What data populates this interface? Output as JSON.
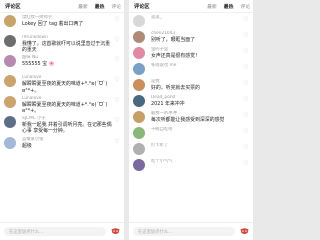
{
  "left": {
    "header": {
      "title": "评论区",
      "tabs": [
        {
          "label": "最新"
        },
        {
          "label": "最热"
        },
        {
          "label": "评论"
        }
      ]
    },
    "comments": [
      {
        "user": "漂红纹一师师学",
        "text": "Lokey 回了 tag 着出口两了",
        "likes": "",
        "color": "#c9a46a"
      },
      {
        "user": "r9runkdown",
        "text": "我懂了。这首歌就吓可以说里音过于沉重的重天",
        "likes": "",
        "color": "#6d6d6d"
      },
      {
        "user": "甜味 Nu",
        "text": "555555 宝 🌸",
        "likes": "",
        "color": "#b98ab0"
      },
      {
        "user": "Lunalove",
        "text": "解瞬瞬夏至夜的夏天的味道+*.°ʚ(ˊᗜˋ)ɞ°*+。",
        "likes": "",
        "color": "#caa36e"
      },
      {
        "user": "Lunalove",
        "text": "解瞬瞬夏至夜的夏天的味道+*.°ʚ(ˊᗜˋ)ɞ°*+。",
        "likes": "",
        "color": "#caa36e"
      },
      {
        "user": "SJCMC 小子",
        "text": "新我一起我 并着引调听月亮。在记那些偶心事 享受每一分钟。",
        "likes": "",
        "color": "#5f6e88"
      },
      {
        "user": "蓝莓某小兔",
        "text": "超级",
        "likes": "",
        "color": "#a3b8d6"
      }
    ],
    "input": {
      "placeholder": "在这里说点什么..."
    }
  },
  "right": {
    "header": {
      "title": "评论区",
      "tabs": [
        {
          "label": "最新"
        },
        {
          "label": "最热"
        },
        {
          "label": "评论"
        }
      ]
    },
    "comments": [
      {
        "user": "淡淡_",
        "text": "",
        "likes": "",
        "color": "#d8d8d8"
      },
      {
        "user": "chen21043",
        "text": "别听了，眼眶当面了",
        "likes": "",
        "color": "#b08a78"
      },
      {
        "user": "萤的子萤",
        "text": "女声还真是很有感觉！",
        "likes": "",
        "color": "#e08aa4"
      },
      {
        "user": "冬雨说也 me",
        "text": "",
        "likes": "",
        "color": "#7aa0c8"
      },
      {
        "user": "是我",
        "text": "好的，听完就去买票的",
        "likes": "",
        "color": "#c98f5c"
      },
      {
        "user": "Dead_pond",
        "text": "2021 年来冲冲",
        "likes": "",
        "color": "#48697e"
      },
      {
        "user": "最我一听冲冲",
        "text": "每次听都能让我感受到深深的感觉",
        "likes": "",
        "color": "#c7a067"
      },
      {
        "user": "千碗自吃吧",
        "text": "",
        "likes": "",
        "color": "#8ab87a"
      },
      {
        "user": "打卡听了",
        "text": "",
        "likes": "",
        "color": "#b0b0b0"
      },
      {
        "user": "吃个小气气",
        "text": "",
        "likes": "",
        "color": "#7a6aa0"
      }
    ],
    "input": {
      "placeholder": "在这里说点什么..."
    }
  }
}
